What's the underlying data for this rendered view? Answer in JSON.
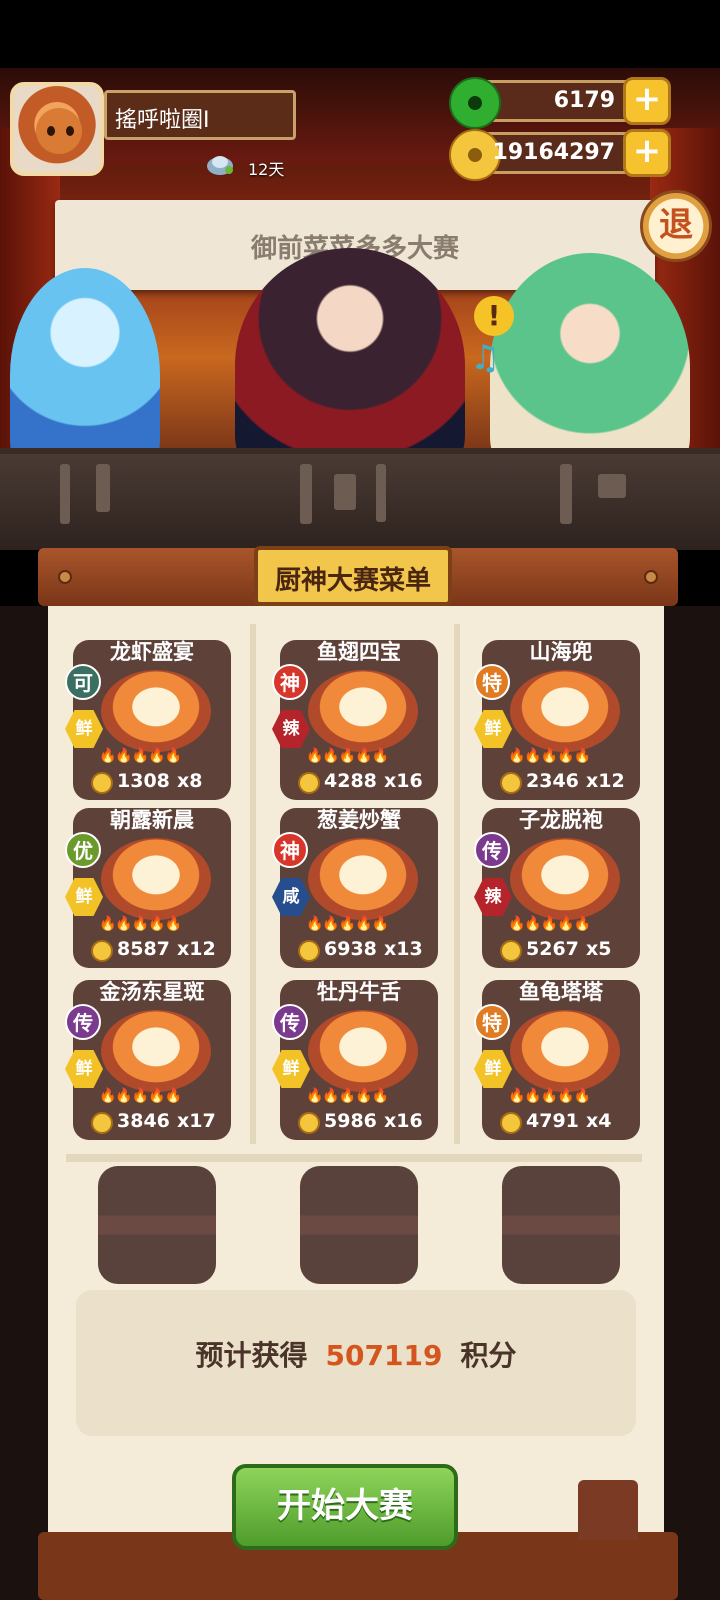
{
  "hud": {
    "player_name": "搖呼啦圈I",
    "days": "12天",
    "jade": "6179",
    "gold": "19164297",
    "plus": "+",
    "quit": "退"
  },
  "scene": {
    "banner": "御前菜菜多多大赛",
    "exclaim": "!",
    "note": "♫"
  },
  "menu": {
    "title": "厨神大赛菜单",
    "dishes": [
      {
        "name": "龙虾盛宴",
        "rank": "可",
        "flavor": "鲜",
        "price": "1308",
        "count": "x8"
      },
      {
        "name": "鱼翅四宝",
        "rank": "神",
        "flavor": "辣",
        "price": "4288",
        "count": "x16"
      },
      {
        "name": "山海兜",
        "rank": "特",
        "flavor": "鲜",
        "price": "2346",
        "count": "x12"
      },
      {
        "name": "朝露新晨",
        "rank": "优",
        "flavor": "鲜",
        "price": "8587",
        "count": "x12"
      },
      {
        "name": "葱姜炒蟹",
        "rank": "神",
        "flavor": "咸",
        "price": "6938",
        "count": "x13"
      },
      {
        "name": "子龙脱袍",
        "rank": "传",
        "flavor": "辣",
        "price": "5267",
        "count": "x5"
      },
      {
        "name": "金汤东星斑",
        "rank": "传",
        "flavor": "鲜",
        "price": "3846",
        "count": "x17"
      },
      {
        "name": "牡丹牛舌",
        "rank": "传",
        "flavor": "鲜",
        "price": "5986",
        "count": "x16"
      },
      {
        "name": "鱼龟塔塔",
        "rank": "特",
        "flavor": "鲜",
        "price": "4791",
        "count": "x4"
      }
    ]
  },
  "score": {
    "label": "预计获得",
    "value": "507119",
    "unit": "积分"
  },
  "start_button": "开始大赛",
  "flames": "🔥🔥🔥🔥🔥"
}
